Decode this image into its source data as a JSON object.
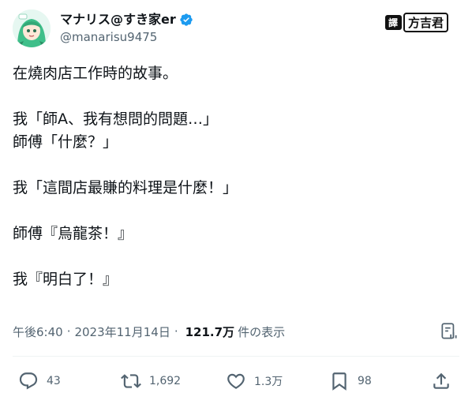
{
  "user": {
    "display_name": "マナリス@すき家er",
    "handle": "@manarisu9475"
  },
  "watermark": {
    "tag": "譯",
    "translator": "方吉君"
  },
  "tweet": {
    "line1": "在燒肉店工作時的故事。",
    "line2": "我「師A、我有想問的問題…」",
    "line3": "師傅「什麼？」",
    "line4": "我「這間店最賺的料理是什麼！」",
    "line5": "師傅『烏龍茶！』",
    "line6": "我『明白了！』"
  },
  "meta": {
    "time": "午後6:40",
    "date": "2023年11月14日",
    "views_count": "121.7万",
    "views_label": "件の表示",
    "separator": "·"
  },
  "actions": {
    "replies": "43",
    "retweets": "1,692",
    "likes": "1.3万",
    "bookmarks": "98"
  },
  "colors": {
    "verified": "#1d9bf0",
    "secondary_text": "#536471",
    "primary_text": "#0f1419",
    "avatar_hair": "#3fbf8a"
  }
}
